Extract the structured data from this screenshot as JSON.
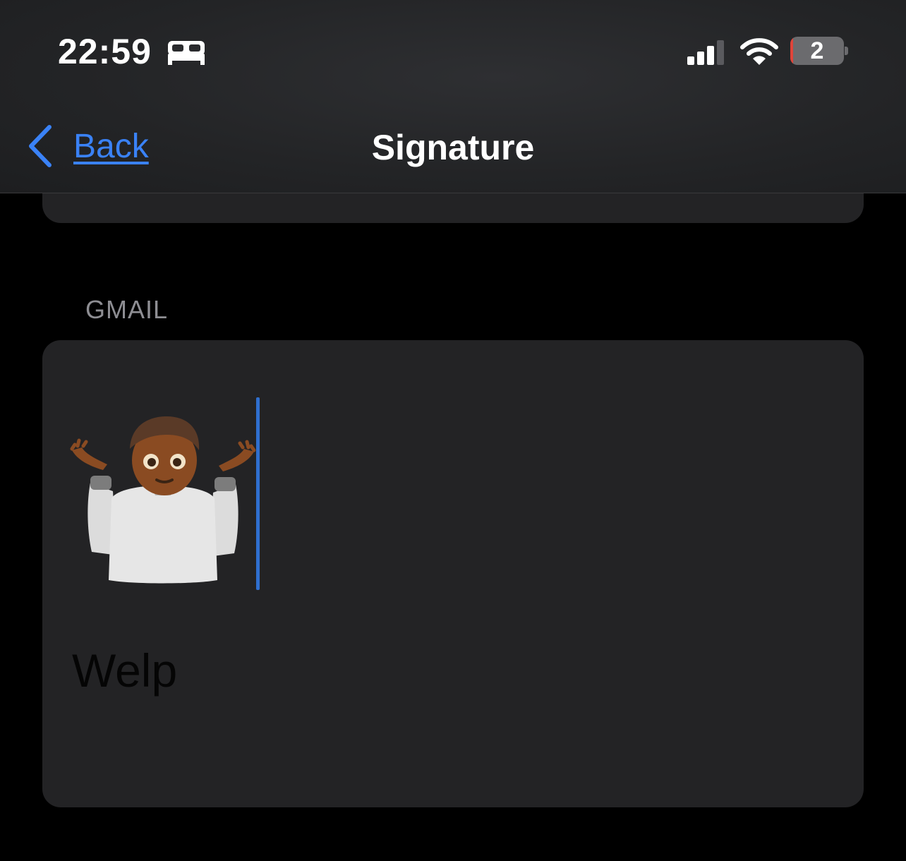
{
  "status_bar": {
    "time": "22:59",
    "focus_icon": "bed-icon",
    "signal_icon": "cellular-signal-icon",
    "wifi_icon": "wifi-icon",
    "battery_level": "2",
    "battery_low_color": "#e0443a"
  },
  "nav": {
    "back_label": "Back",
    "back_icon": "chevron-left-icon",
    "title": "Signature",
    "accent_color": "#3a82f7"
  },
  "sections": [
    {
      "header": "GMAIL",
      "signature": {
        "emoji": "person-shrugging-emoji",
        "text": "Welp"
      }
    }
  ]
}
